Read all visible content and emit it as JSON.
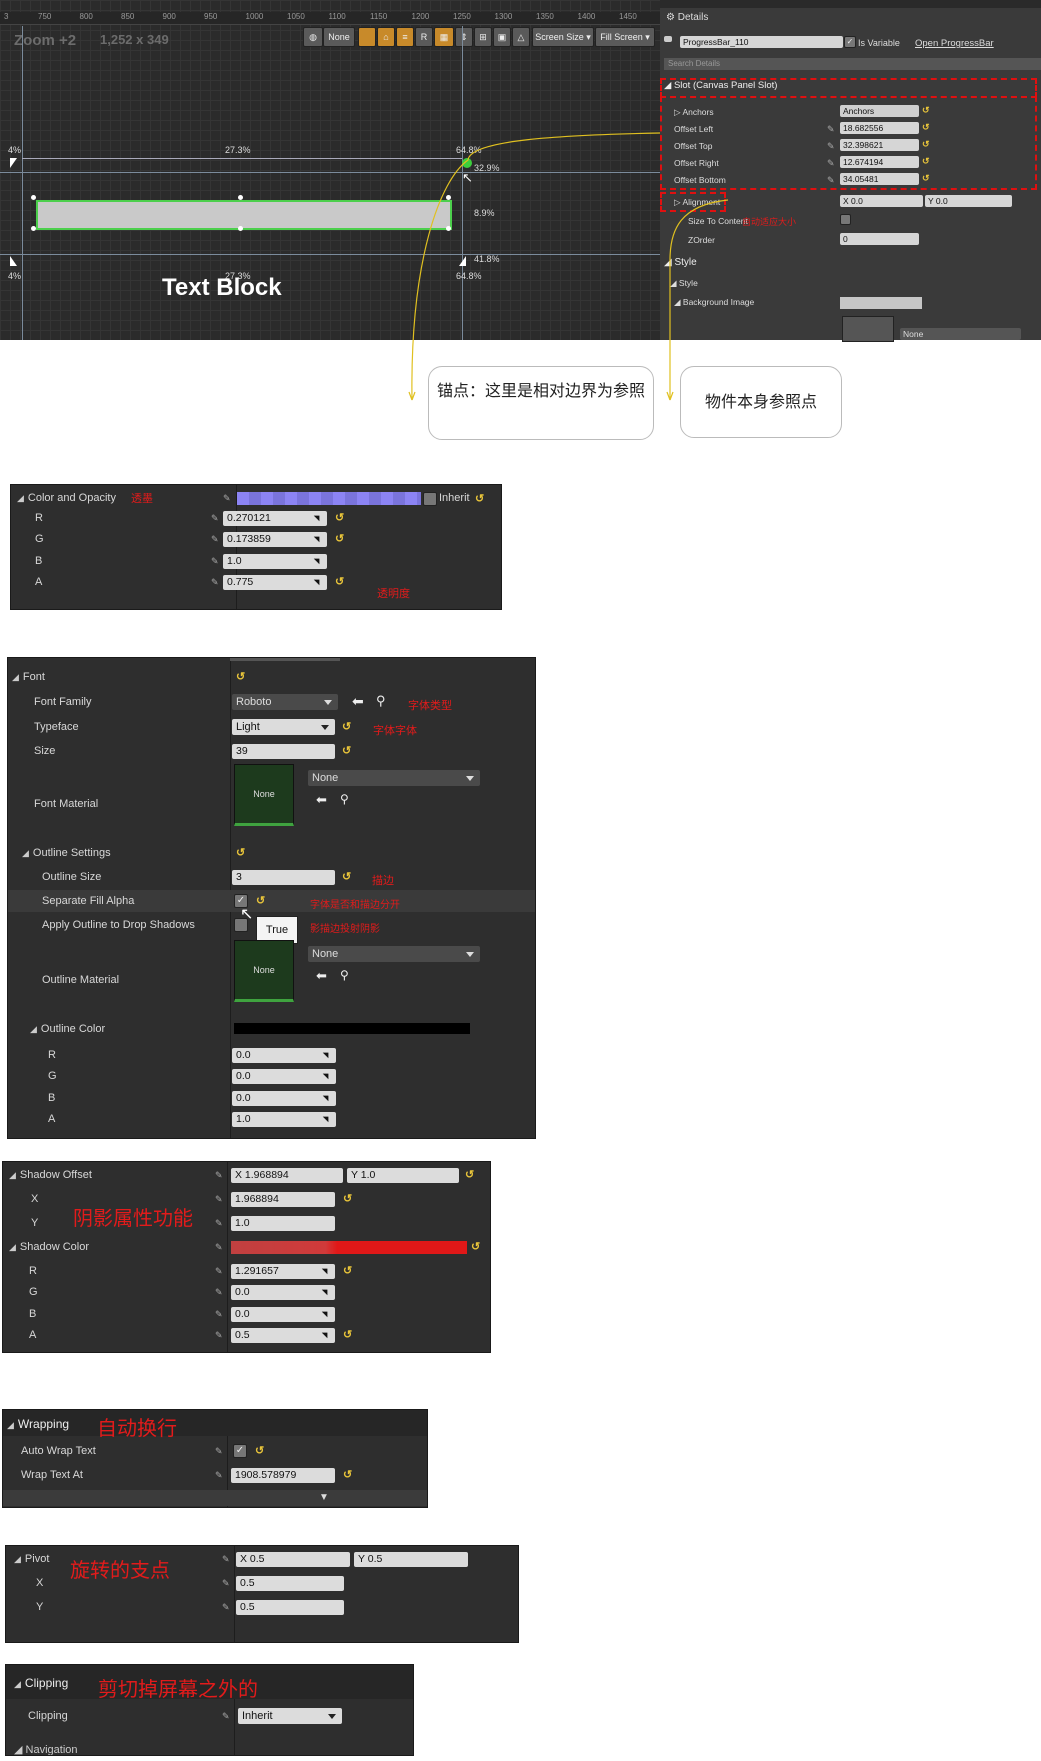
{
  "editor": {
    "ruler_ticks": [
      "3",
      "750",
      "800",
      "850",
      "900",
      "950",
      "1000",
      "1050",
      "1100",
      "1150",
      "1200",
      "1250",
      "1300",
      "1350",
      "1400",
      "1450"
    ],
    "zoom_label": "Zoom +2",
    "resolution_label": "1,252 x 349",
    "toolbar": {
      "none_label": "None",
      "r_label": "R",
      "screen_size_label": "Screen Size",
      "fill_screen_label": "Fill Screen"
    },
    "percentages": {
      "left_top": "4%",
      "mid_top": "27.3%",
      "right_top": "64.8%",
      "anchor_right": "32.9%",
      "height": "8.9%",
      "left_bottom": "4%",
      "mid_bottom": "27.3%",
      "right_bottom_a": "41.8%",
      "right_bottom_b": "64.8%"
    },
    "text_block_label": "Text Block"
  },
  "details": {
    "tab_title": "Details",
    "widget_name": "ProgressBar_110",
    "is_variable_label": "Is Variable",
    "open_label": "Open ProgressBar",
    "search_placeholder": "Search Details",
    "slot_header": "Slot (Canvas Panel Slot)",
    "anchors_label": "Anchors",
    "anchors_value": "Anchors",
    "offsets": [
      {
        "label": "Offset Left",
        "value": "18.682556"
      },
      {
        "label": "Offset Top",
        "value": "32.398621"
      },
      {
        "label": "Offset Right",
        "value": "12.674194"
      },
      {
        "label": "Offset Bottom",
        "value": "34.05481"
      }
    ],
    "alignment_label": "Alignment",
    "alignment_x": "X 0.0",
    "alignment_y": "Y 0.0",
    "size_to_content_label": "Size To Content",
    "size_to_content_note": "自动适应大小",
    "zorder_label": "ZOrder",
    "zorder_value": "0",
    "style_header": "Style",
    "style_sub": "Style",
    "background_image_label": "Background Image",
    "bg_none": "None"
  },
  "callouts": {
    "anchor_note": "锚点：这里是相对边界为参照",
    "pivot_note": "物件本身参照点"
  },
  "color_opacity": {
    "label": "Color and Opacity",
    "note": "透墨",
    "inherit_label": "Inherit",
    "swatch_color": "#8c84f4",
    "channels": [
      {
        "label": "R",
        "value": "0.270121"
      },
      {
        "label": "G",
        "value": "0.173859"
      },
      {
        "label": "B",
        "value": "1.0"
      },
      {
        "label": "A",
        "value": "0.775"
      }
    ],
    "alpha_note": "透明度"
  },
  "font": {
    "header": "Font",
    "rows": {
      "family_label": "Font Family",
      "family_value": "Roboto",
      "family_note": "字体类型",
      "typeface_label": "Typeface",
      "typeface_value": "Light",
      "typeface_note": "字体字体",
      "size_label": "Size",
      "size_value": "39",
      "material_label": "Font Material",
      "material_thumb": "None",
      "material_dropdown": "None"
    },
    "outline": {
      "header": "Outline Settings",
      "size_label": "Outline Size",
      "size_value": "3",
      "size_note": "描边",
      "sep_fill_label": "Separate Fill Alpha",
      "sep_fill_note": "字体是否和描边分开",
      "apply_shadow_label": "Apply Outline to Drop Shadows",
      "apply_shadow_note": "影描边投射阴影",
      "tooltip": "True",
      "material_label": "Outline Material",
      "material_thumb": "None",
      "material_dropdown": "None",
      "color_header": "Outline Color",
      "channels": [
        {
          "label": "R",
          "value": "0.0"
        },
        {
          "label": "G",
          "value": "0.0"
        },
        {
          "label": "B",
          "value": "0.0"
        },
        {
          "label": "A",
          "value": "1.0"
        }
      ]
    }
  },
  "shadow": {
    "offset_label": "Shadow Offset",
    "offset_x": "X 1.968894",
    "offset_y": "Y 1.0",
    "x_label": "X",
    "x_value": "1.968894",
    "y_label": "Y",
    "y_value": "1.0",
    "note": "阴影属性功能",
    "color_label": "Shadow Color",
    "color_swatch": "#e01818",
    "channels": [
      {
        "label": "R",
        "value": "1.291657"
      },
      {
        "label": "G",
        "value": "0.0"
      },
      {
        "label": "B",
        "value": "0.0"
      },
      {
        "label": "A",
        "value": "0.5"
      }
    ]
  },
  "wrapping": {
    "header": "Wrapping",
    "note": "自动换行",
    "auto_wrap_label": "Auto Wrap Text",
    "wrap_at_label": "Wrap Text At",
    "wrap_at_value": "1908.578979"
  },
  "pivot": {
    "header": "Pivot",
    "note": "旋转的支点",
    "x_combined": "X 0.5",
    "y_combined": "Y 0.5",
    "x_label": "X",
    "x_value": "0.5",
    "y_label": "Y",
    "y_value": "0.5"
  },
  "clipping": {
    "header": "Clipping",
    "note": "剪切掉屏幕之外的",
    "row_label": "Clipping",
    "value": "Inherit",
    "next_header": "Navigation"
  }
}
